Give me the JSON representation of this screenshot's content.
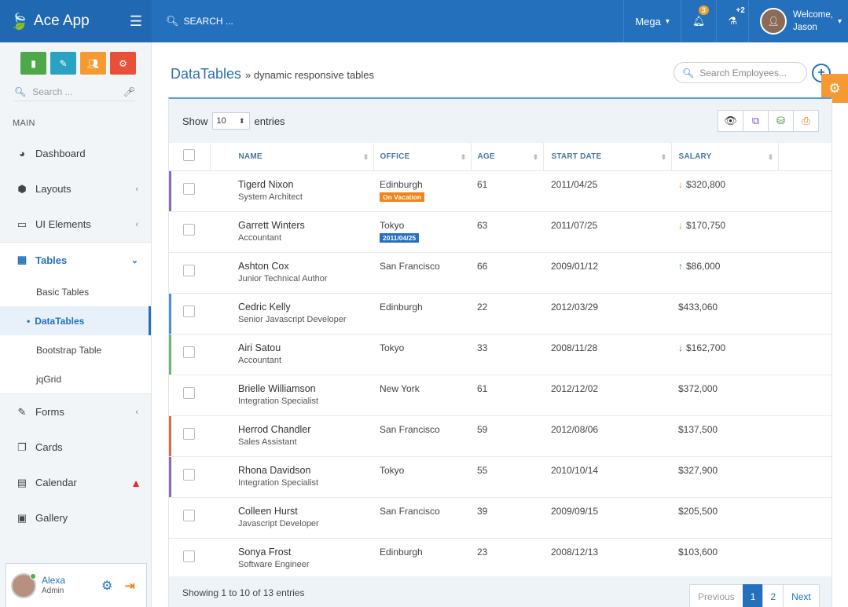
{
  "app": {
    "brand": "Ace App",
    "search_placeholder": "SEARCH ..."
  },
  "navbar": {
    "mega": "Mega",
    "notif_count": "3",
    "tasks_badge": "+2",
    "welcome": "Welcome,",
    "user": "Jason"
  },
  "sidebar": {
    "search_placeholder": "Search ...",
    "section": "MAIN",
    "items": [
      {
        "label": "Dashboard",
        "icon": "dashboard-icon"
      },
      {
        "label": "Layouts",
        "icon": "cube-icon"
      },
      {
        "label": "UI Elements",
        "icon": "desktop-icon"
      },
      {
        "label": "Tables",
        "icon": "table-icon"
      },
      {
        "label": "Forms",
        "icon": "edit-icon"
      },
      {
        "label": "Cards",
        "icon": "clone-icon"
      },
      {
        "label": "Calendar",
        "icon": "calendar-icon"
      },
      {
        "label": "Gallery",
        "icon": "image-icon"
      }
    ],
    "tables_sub": [
      "Basic Tables",
      "DataTables",
      "Bootstrap Table",
      "jqGrid"
    ],
    "user": {
      "name": "Alexa",
      "role": "Admin"
    }
  },
  "page": {
    "title": "DataTables",
    "subtitle": "» dynamic responsive tables",
    "emp_search_placeholder": "Search Employees..."
  },
  "table": {
    "show_label": "Show",
    "entries_value": "10",
    "entries_label": "entries",
    "headers": [
      "NAME",
      "OFFICE",
      "AGE",
      "START DATE",
      "SALARY"
    ],
    "rows": [
      {
        "name": "Tigerd Nixon",
        "position": "System Architect",
        "office": "Edinburgh",
        "tag": "On Vacation",
        "age": "61",
        "start": "2011/04/25",
        "salary": "$320,800",
        "trend": "down-orange"
      },
      {
        "name": "Garrett Winters",
        "position": "Accountant",
        "office": "Tokyo",
        "tag": "2011/04/25",
        "age": "63",
        "start": "2011/07/25",
        "salary": "$170,750",
        "trend": "down-orange"
      },
      {
        "name": "Ashton Cox",
        "position": "Junior Technical Author",
        "office": "San Francisco",
        "tag": "",
        "age": "66",
        "start": "2009/01/12",
        "salary": "$86,000",
        "trend": "up-blue"
      },
      {
        "name": "Cedric Kelly",
        "position": "Senior Javascript Developer",
        "office": "Edinburgh",
        "tag": "",
        "age": "22",
        "start": "2012/03/29",
        "salary": "$433,060",
        "trend": ""
      },
      {
        "name": "Airi Satou",
        "position": "Accountant",
        "office": "Tokyo",
        "tag": "",
        "age": "33",
        "start": "2008/11/28",
        "salary": "$162,700",
        "trend": "down-red"
      },
      {
        "name": "Brielle Williamson",
        "position": "Integration Specialist",
        "office": "New York",
        "tag": "",
        "age": "61",
        "start": "2012/12/02",
        "salary": "$372,000",
        "trend": ""
      },
      {
        "name": "Herrod Chandler",
        "position": "Sales Assistant",
        "office": "San Francisco",
        "tag": "",
        "age": "59",
        "start": "2012/08/06",
        "salary": "$137,500",
        "trend": ""
      },
      {
        "name": "Rhona Davidson",
        "position": "Integration Specialist",
        "office": "Tokyo",
        "tag": "",
        "age": "55",
        "start": "2010/10/14",
        "salary": "$327,900",
        "trend": ""
      },
      {
        "name": "Colleen Hurst",
        "position": "Javascript Developer",
        "office": "San Francisco",
        "tag": "",
        "age": "39",
        "start": "2009/09/15",
        "salary": "$205,500",
        "trend": ""
      },
      {
        "name": "Sonya Frost",
        "position": "Software Engineer",
        "office": "Edinburgh",
        "tag": "",
        "age": "23",
        "start": "2008/12/13",
        "salary": "$103,600",
        "trend": ""
      }
    ],
    "footer_text": "Showing 1 to 10 of 13 entries",
    "pagination": {
      "prev": "Previous",
      "p1": "1",
      "p2": "2",
      "next": "Next"
    }
  },
  "colors": {
    "primary": "#2470bd",
    "accent": "#f59a33",
    "danger": "#d9342b",
    "success": "#4caf50"
  }
}
